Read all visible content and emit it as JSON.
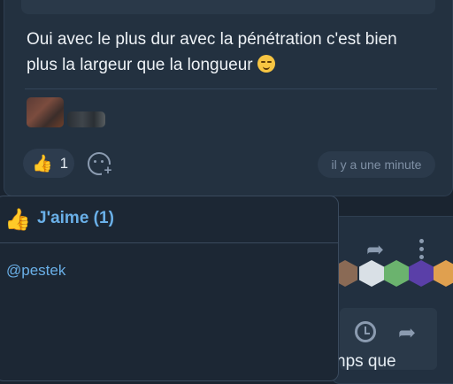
{
  "post": {
    "message": "Oui avec le plus dur avec la pénétration c'est bien plus la largeur que la longueur",
    "emoji": "smirk-emoji",
    "reaction_count": "1",
    "timestamp": "il y a une minute"
  },
  "icons": {
    "like": "thumbs-up-icon",
    "add_reaction": "add-reaction-icon",
    "share": "share-icon",
    "more": "more-vertical-icon",
    "history": "history-icon"
  },
  "second_post": {
    "partial_text": "nps que"
  },
  "popup": {
    "title": "J'aime (1)",
    "users": [
      "@pestek"
    ]
  },
  "colors": {
    "background": "#1a2430",
    "card": "#233140",
    "accent_blue": "#6ab0e8",
    "thumb_yellow": "#f4c542",
    "muted": "#8b9bb0"
  }
}
